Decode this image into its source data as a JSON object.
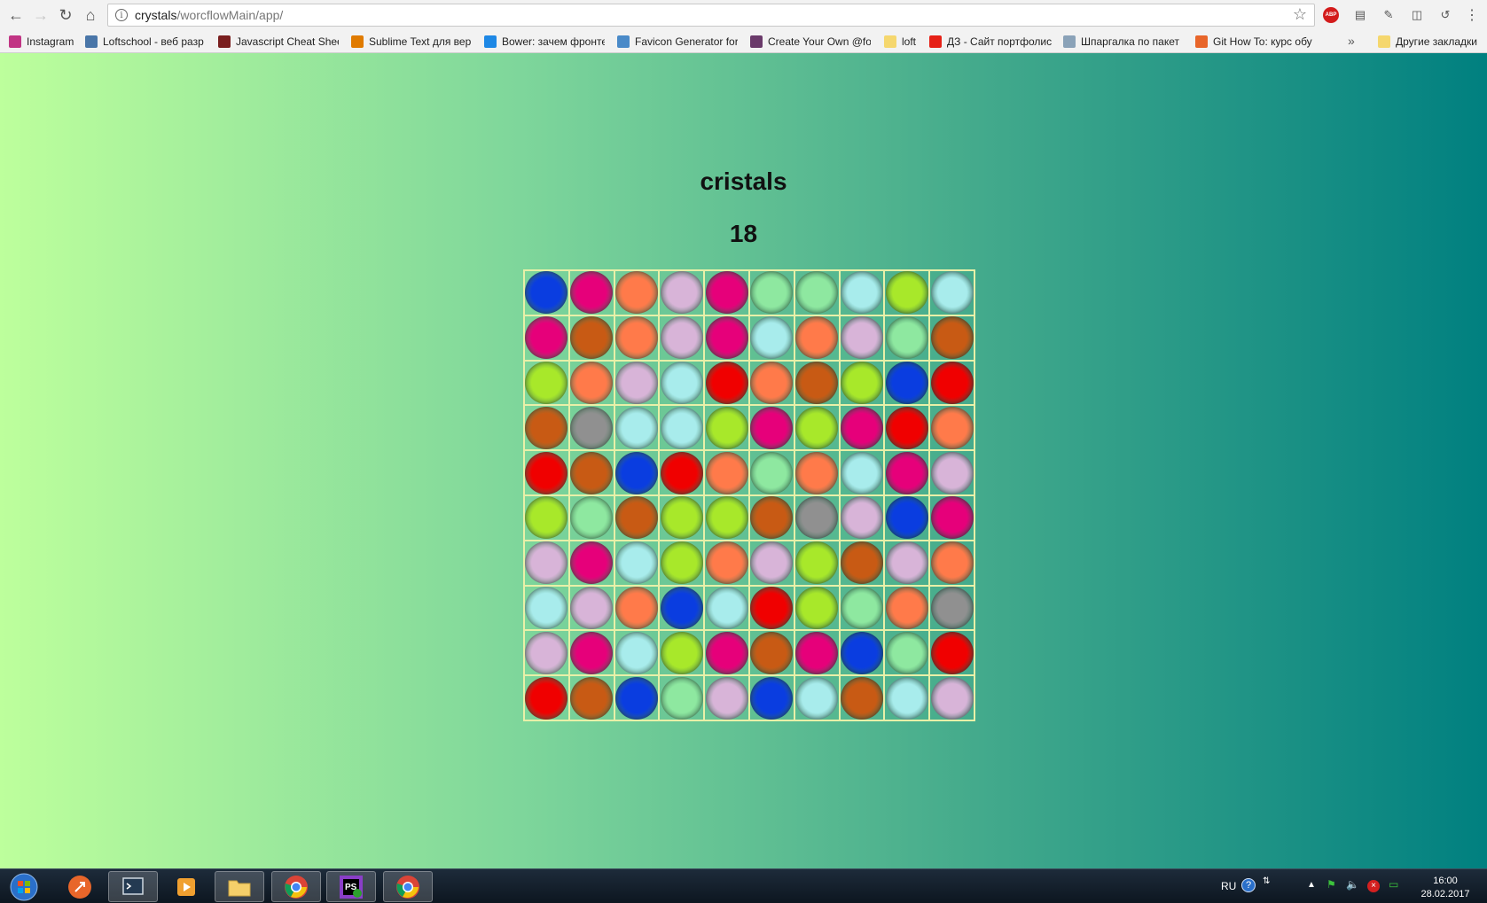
{
  "browser": {
    "url_host": "crystals",
    "url_path": "/worcflowMain/app/",
    "bookmarks": [
      {
        "label": "Instagram",
        "color": "#c13584"
      },
      {
        "label": "Loftschool - веб разр",
        "color": "#4a76a8"
      },
      {
        "label": "Javascript Cheat Shee",
        "color": "#7a1f1f"
      },
      {
        "label": "Sublime Text для вер",
        "color": "#e07b00"
      },
      {
        "label": "Bower: зачем фронте",
        "color": "#1e88e5"
      },
      {
        "label": "Favicon Generator for",
        "color": "#4a8ac8"
      },
      {
        "label": "Create Your Own @fo",
        "color": "#6a3a6a"
      },
      {
        "label": "loft",
        "color": "#f5d76e"
      },
      {
        "label": "ДЗ - Сайт портфолис",
        "color": "#e62117"
      },
      {
        "label": "Шпаргалка по пакет",
        "color": "#8aa2b8"
      },
      {
        "label": "Git How To: курс обу",
        "color": "#e8662a"
      }
    ],
    "bookmarks_more": "»",
    "other_bookmarks": "Другие закладки"
  },
  "game": {
    "title": "cristals",
    "score": "18",
    "colors": {
      "B": "#0a3de0",
      "M": "#e6007a",
      "O": "#ff7a4a",
      "L": "#d8b4d8",
      "G": "#8ee8a0",
      "C": "#a8ecec",
      "Y": "#a8e82a",
      "R": "#f00000",
      "N": "#c85a14",
      "S": "#909090"
    },
    "grid": [
      [
        "B",
        "M",
        "O",
        "L",
        "M",
        "G",
        "G",
        "C",
        "Y",
        "C"
      ],
      [
        "M",
        "N",
        "O",
        "L",
        "M",
        "C",
        "O",
        "L",
        "G",
        "N"
      ],
      [
        "Y",
        "O",
        "L",
        "C",
        "R",
        "O",
        "N",
        "Y",
        "B",
        "R"
      ],
      [
        "N",
        "S",
        "C",
        "C",
        "Y",
        "M",
        "Y",
        "M",
        "R",
        "O"
      ],
      [
        "R",
        "N",
        "B",
        "R",
        "O",
        "G",
        "O",
        "C",
        "M",
        "L"
      ],
      [
        "Y",
        "G",
        "N",
        "Y",
        "Y",
        "N",
        "S",
        "L",
        "B",
        "M"
      ],
      [
        "L",
        "M",
        "C",
        "Y",
        "O",
        "L",
        "Y",
        "N",
        "L",
        "O"
      ],
      [
        "C",
        "L",
        "O",
        "B",
        "C",
        "R",
        "Y",
        "G",
        "O",
        "S"
      ],
      [
        "L",
        "M",
        "C",
        "Y",
        "M",
        "N",
        "M",
        "B",
        "G",
        "R"
      ],
      [
        "R",
        "N",
        "B",
        "G",
        "L",
        "B",
        "C",
        "N",
        "C",
        "L"
      ]
    ]
  },
  "taskbar": {
    "lang": "RU",
    "time": "16:00",
    "date": "28.02.2017"
  }
}
